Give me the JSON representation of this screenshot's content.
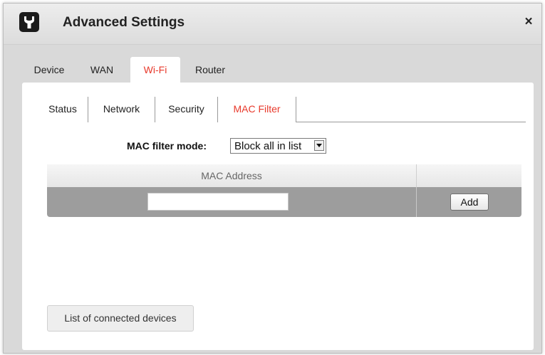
{
  "window": {
    "title": "Advanced Settings",
    "close_symbol": "×",
    "icons": {
      "app": "wrench-icon",
      "close": "close-icon"
    }
  },
  "main_tabs": [
    {
      "label": "Device",
      "active": false
    },
    {
      "label": "WAN",
      "active": false
    },
    {
      "label": "Wi-Fi",
      "active": true
    },
    {
      "label": "Router",
      "active": false
    }
  ],
  "sub_tabs": [
    {
      "label": "Status",
      "active": false
    },
    {
      "label": "Network",
      "active": false
    },
    {
      "label": "Security",
      "active": false
    },
    {
      "label": "MAC Filter",
      "active": true
    }
  ],
  "mac_filter": {
    "mode_label": "MAC filter mode:",
    "mode_value": "Block all in list"
  },
  "table": {
    "header": "MAC Address",
    "mac_value": "",
    "add_label": "Add"
  },
  "connected_devices_label": "List of connected devices",
  "colors": {
    "accent": "#e8392b",
    "dialog_bg": "#d9d9d9",
    "row_bg": "#9d9d9d"
  }
}
